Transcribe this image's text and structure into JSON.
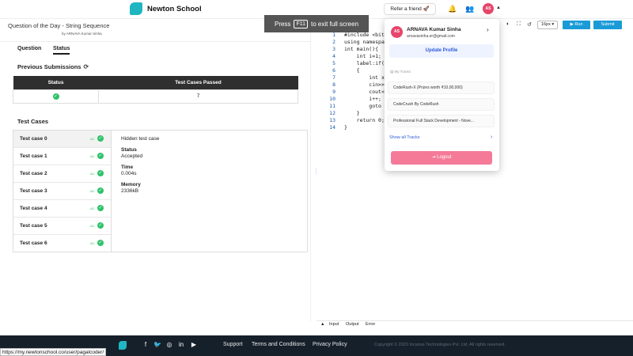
{
  "nav": {
    "brand": "Newton School",
    "refer_label": "Refer a friend 🚀",
    "avatar_initials": "AS"
  },
  "problem": {
    "title": "Question of the Day - String Sequence",
    "author": "by ARNAVA Kumar Sinha"
  },
  "toast": {
    "prefix": "Press",
    "key": "F11",
    "suffix": "to exit full screen"
  },
  "tabs": [
    {
      "label": "Question",
      "active": false
    },
    {
      "label": "Status",
      "active": true
    }
  ],
  "previous_submissions": {
    "heading": "Previous Submissions",
    "columns": [
      "Status",
      "Test Cases Passed"
    ],
    "rows": [
      {
        "status": "accepted",
        "passed": "7"
      }
    ]
  },
  "test_cases": {
    "heading": "Test Cases",
    "items": [
      {
        "label": "Test case 0",
        "badge": "AC"
      },
      {
        "label": "Test case 1",
        "badge": "AC"
      },
      {
        "label": "Test case 2",
        "badge": "AC"
      },
      {
        "label": "Test case 3",
        "badge": "AC"
      },
      {
        "label": "Test case 4",
        "badge": "AC"
      },
      {
        "label": "Test case 5",
        "badge": "AC"
      },
      {
        "label": "Test case 6",
        "badge": "AC"
      }
    ],
    "detail": {
      "note": "Hidden test case",
      "status_label": "Status",
      "status_value": "Accepted",
      "time_label": "Time",
      "time_value": "0.004s",
      "memory_label": "Memory",
      "memory_value": "2336kB"
    }
  },
  "editor": {
    "font_size": "16px ▾",
    "run_label": "▶ Run",
    "submit_label": "Submit",
    "lines": [
      {
        "n": "1",
        "text": "#include <bit"
      },
      {
        "n": "2",
        "text": "using namespa"
      },
      {
        "n": "3",
        "text": "int main(){"
      },
      {
        "n": "4",
        "text": "    int i=1;"
      },
      {
        "n": "5",
        "text": "    label:if("
      },
      {
        "n": "6",
        "text": "    {"
      },
      {
        "n": "7",
        "text": "        int x"
      },
      {
        "n": "8",
        "text": "        cin>>"
      },
      {
        "n": "9",
        "text": "        cout<"
      },
      {
        "n": "10",
        "text": "        i++;"
      },
      {
        "n": "11",
        "text": "        goto "
      },
      {
        "n": "12",
        "text": "    }"
      },
      {
        "n": "13",
        "text": "    return 0;"
      },
      {
        "n": "14",
        "text": "}"
      }
    ],
    "io_tabs": [
      "Input",
      "Output",
      "Error"
    ]
  },
  "dropdown": {
    "avatar_initials": "AS",
    "name": "ARNAVA Kumar Sinha",
    "email": "arnavasinha.er@gmail.com",
    "update_profile": "Update Profile",
    "tracks_heading": "My Tracks",
    "tracks": [
      "CodeRush-X (Prizes worth ₹10,00,000)",
      "CodeCrush By CodeRush",
      "Professional Full Stack Development - Nove..."
    ],
    "show_all": "Show all Tracks",
    "logout": "Logout"
  },
  "footer": {
    "links": [
      "Support",
      "Terms and Conditions",
      "Privacy Policy"
    ],
    "copyright": "Copyright © 2023 Incanus Technologies Pvt. Ltd. All rights reserved.",
    "status_url": "https://my.newtonschool.co/user/pagalcoder/"
  },
  "colors": {
    "accent": "#1a9bd7",
    "brand": "#1fb6c1",
    "success": "#2ec26a",
    "logout": "#f47a98",
    "footer_bg": "#16202a"
  }
}
